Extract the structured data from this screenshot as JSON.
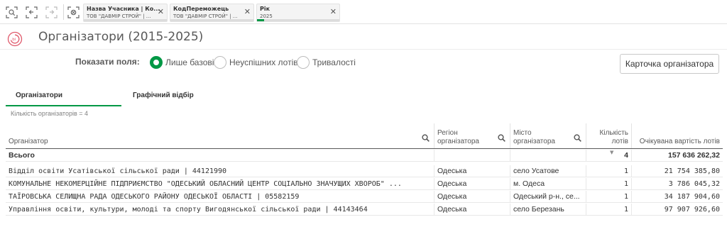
{
  "selection_bar": {
    "chips": [
      {
        "title": "Назва Учасника | Ко...",
        "value": "ТОВ \"ДАВМІР СТРОЙ\" | ..."
      },
      {
        "title": "КодПереможець",
        "value": "ТОВ \"ДАВМІР СТРОЙ\" | ..."
      },
      {
        "title": "Рік",
        "value": "2025"
      }
    ],
    "close_glyph": "✕",
    "accent": "#009845"
  },
  "header": {
    "title": "Організатори (2015-2025)"
  },
  "fields": {
    "label": "Показати поля:",
    "options": [
      {
        "label": "Лише базові",
        "selected": true
      },
      {
        "label": "Неуспішних лотів",
        "selected": false
      },
      {
        "label": "Тривалості",
        "selected": false
      }
    ],
    "card_button": "Карточка організатора"
  },
  "tabs": [
    {
      "label": "Організатори",
      "active": true
    },
    {
      "label": "Графічний відбір",
      "active": false
    }
  ],
  "count_text": "Кількість організаторів = 4",
  "table": {
    "headers": {
      "organizer": "Організатор",
      "region_l1": "Регіон",
      "region_l2": "організатора",
      "city_l1": "Місто",
      "city_l2": "організатора",
      "lots_l1": "Кількість",
      "lots_l2": "лотів",
      "value": "Очікувана вартість лотів"
    },
    "total": {
      "label": "Всього",
      "lots": "4",
      "value": "157 636 262,32"
    },
    "rows": [
      {
        "organizer": "Відділ освіти Усатівської сільської ради | 44121990",
        "region": "Одеська",
        "city": "село Усатове",
        "lots": "1",
        "value": "21 754 385,80"
      },
      {
        "organizer": "КОМУНАЛЬНЕ НЕКОМЕРЦІЙНЕ ПІДПРИЄМСТВО \"ОДЕСЬКИЙ ОБЛАСНИЙ ЦЕНТР СОЦІАЛЬНО ЗНАЧУЩИХ ХВОРОБ\" ...",
        "region": "Одеська",
        "city": "м. Одеса",
        "lots": "1",
        "value": "3 786 045,32"
      },
      {
        "organizer": "ТАЇРОВСЬКА СЕЛИЩНА РАДА ОДЕСЬКОГО РАЙОНУ ОДЕСЬКОЇ ОБЛАСТІ | 05582159",
        "region": "Одеська",
        "city": "Одеський р-н., се...",
        "lots": "1",
        "value": "34 187 904,60"
      },
      {
        "organizer": "Управління освіти, культури, молоді та спорту Вигодянської сільської ради | 44143464",
        "region": "Одеська",
        "city": "село Березань",
        "lots": "1",
        "value": "97 907 926,60"
      }
    ]
  }
}
